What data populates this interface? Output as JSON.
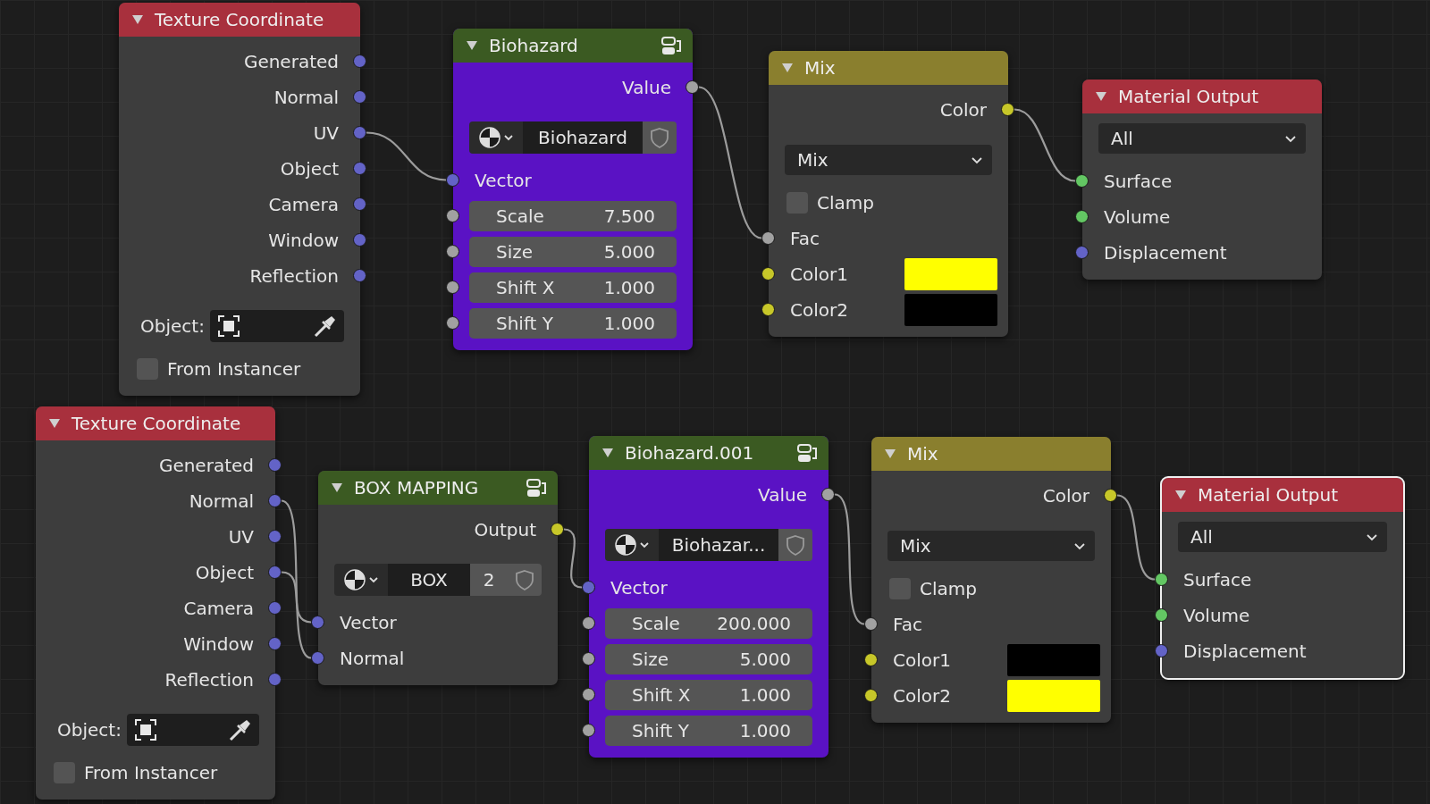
{
  "nodes": [
    {
      "title": "Texture Coordinate",
      "kind": "node",
      "color": "#a8303d",
      "selected": false,
      "group": false,
      "rows": [
        {
          "kind": "output",
          "label": "Generated",
          "socket": {
            "kind": "vector"
          }
        },
        {
          "kind": "output",
          "label": "Normal",
          "socket": {
            "kind": "vector"
          }
        },
        {
          "kind": "output",
          "label": "UV",
          "socket": {
            "kind": "vector"
          }
        },
        {
          "kind": "output",
          "label": "Object",
          "socket": {
            "kind": "vector"
          }
        },
        {
          "kind": "output",
          "label": "Camera",
          "socket": {
            "kind": "vector"
          }
        },
        {
          "kind": "output",
          "label": "Window",
          "socket": {
            "kind": "vector"
          }
        },
        {
          "kind": "output",
          "label": "Reflection",
          "socket": {
            "kind": "vector"
          }
        },
        {
          "kind": "object_field",
          "label": "Object:"
        },
        {
          "kind": "checkbox",
          "label": "From Instancer",
          "checked": false
        }
      ]
    },
    {
      "title": "Biohazard",
      "kind": "group_texture",
      "color": "#3b5a22",
      "selected": false,
      "group": true,
      "rows": [
        {
          "kind": "output",
          "label": "Value",
          "socket": {
            "kind": "float"
          }
        },
        {
          "kind": "datablock",
          "name": "Biohazard"
        },
        {
          "kind": "input",
          "label": "Vector",
          "socket": {
            "kind": "vector"
          }
        },
        {
          "kind": "slider",
          "label": "Scale",
          "value": "7.500",
          "socket": {
            "kind": "float"
          }
        },
        {
          "kind": "slider",
          "label": "Size",
          "value": "5.000",
          "socket": {
            "kind": "float"
          }
        },
        {
          "kind": "slider",
          "label": "Shift X",
          "value": "1.000",
          "socket": {
            "kind": "float"
          }
        },
        {
          "kind": "slider",
          "label": "Shift Y",
          "value": "1.000",
          "socket": {
            "kind": "float"
          }
        }
      ]
    },
    {
      "title": "Mix",
      "kind": "node",
      "color": "#8a7f2e",
      "selected": false,
      "group": false,
      "rows": [
        {
          "kind": "output",
          "label": "Color",
          "socket": {
            "kind": "color"
          }
        },
        {
          "kind": "dropdown",
          "value": "Mix"
        },
        {
          "kind": "checkbox",
          "label": "Clamp",
          "checked": false
        },
        {
          "kind": "input",
          "label": "Fac",
          "socket": {
            "kind": "float"
          }
        },
        {
          "kind": "color_input",
          "label": "Color1",
          "socket": {
            "kind": "color"
          },
          "color": "#ffff00"
        },
        {
          "kind": "color_input",
          "label": "Color2",
          "socket": {
            "kind": "color"
          },
          "color": "#000000"
        }
      ]
    },
    {
      "title": "Material Output",
      "kind": "node",
      "color": "#a8303d",
      "selected": false,
      "group": false,
      "rows": [
        {
          "kind": "dropdown",
          "value": "All"
        },
        {
          "kind": "input",
          "label": "Surface",
          "socket": {
            "kind": "shader"
          }
        },
        {
          "kind": "input",
          "label": "Volume",
          "socket": {
            "kind": "shader"
          }
        },
        {
          "kind": "input",
          "label": "Displacement",
          "socket": {
            "kind": "vector"
          }
        }
      ]
    },
    {
      "title": "Texture Coordinate",
      "kind": "node",
      "color": "#a8303d",
      "selected": false,
      "group": false,
      "rows": [
        {
          "kind": "output",
          "label": "Generated",
          "socket": {
            "kind": "vector"
          }
        },
        {
          "kind": "output",
          "label": "Normal",
          "socket": {
            "kind": "vector"
          }
        },
        {
          "kind": "output",
          "label": "UV",
          "socket": {
            "kind": "vector"
          }
        },
        {
          "kind": "output",
          "label": "Object",
          "socket": {
            "kind": "vector"
          }
        },
        {
          "kind": "output",
          "label": "Camera",
          "socket": {
            "kind": "vector"
          }
        },
        {
          "kind": "output",
          "label": "Window",
          "socket": {
            "kind": "vector"
          }
        },
        {
          "kind": "output",
          "label": "Reflection",
          "socket": {
            "kind": "vector"
          }
        },
        {
          "kind": "object_field",
          "label": "Object:"
        },
        {
          "kind": "checkbox",
          "label": "From Instancer",
          "checked": false
        }
      ]
    },
    {
      "title": "BOX MAPPING",
      "kind": "group",
      "color": "#3b5a22",
      "selected": false,
      "group": true,
      "rows": [
        {
          "kind": "output",
          "label": "Output",
          "socket": {
            "kind": "color"
          }
        },
        {
          "kind": "datablock",
          "name": "BOX",
          "count": "2"
        },
        {
          "kind": "input",
          "label": "Vector",
          "socket": {
            "kind": "vector"
          }
        },
        {
          "kind": "input",
          "label": "Normal",
          "socket": {
            "kind": "vector"
          }
        }
      ]
    },
    {
      "title": "Biohazard.001",
      "kind": "group_texture",
      "color": "#3b5a22",
      "selected": false,
      "group": true,
      "rows": [
        {
          "kind": "output",
          "label": "Value",
          "socket": {
            "kind": "float"
          }
        },
        {
          "kind": "datablock",
          "name": "Biohazar..."
        },
        {
          "kind": "input",
          "label": "Vector",
          "socket": {
            "kind": "vector"
          }
        },
        {
          "kind": "slider",
          "label": "Scale",
          "value": "200.000",
          "socket": {
            "kind": "float"
          }
        },
        {
          "kind": "slider",
          "label": "Size",
          "value": "5.000",
          "socket": {
            "kind": "float"
          }
        },
        {
          "kind": "slider",
          "label": "Shift X",
          "value": "1.000",
          "socket": {
            "kind": "float"
          }
        },
        {
          "kind": "slider",
          "label": "Shift Y",
          "value": "1.000",
          "socket": {
            "kind": "float"
          }
        }
      ]
    },
    {
      "title": "Mix",
      "kind": "node",
      "color": "#8a7f2e",
      "selected": false,
      "group": false,
      "rows": [
        {
          "kind": "output",
          "label": "Color",
          "socket": {
            "kind": "color"
          }
        },
        {
          "kind": "dropdown",
          "value": "Mix"
        },
        {
          "kind": "checkbox",
          "label": "Clamp",
          "checked": false
        },
        {
          "kind": "input",
          "label": "Fac",
          "socket": {
            "kind": "float"
          }
        },
        {
          "kind": "color_input",
          "label": "Color1",
          "socket": {
            "kind": "color"
          },
          "color": "#000000"
        },
        {
          "kind": "color_input",
          "label": "Color2",
          "socket": {
            "kind": "color"
          },
          "color": "#ffff00"
        }
      ]
    },
    {
      "title": "Material Output",
      "kind": "node",
      "color": "#a8303d",
      "selected": true,
      "group": false,
      "rows": [
        {
          "kind": "dropdown",
          "value": "All"
        },
        {
          "kind": "input",
          "label": "Surface",
          "socket": {
            "kind": "shader"
          }
        },
        {
          "kind": "input",
          "label": "Volume",
          "socket": {
            "kind": "shader"
          }
        },
        {
          "kind": "input",
          "label": "Displacement",
          "socket": {
            "kind": "vector"
          }
        }
      ]
    }
  ]
}
